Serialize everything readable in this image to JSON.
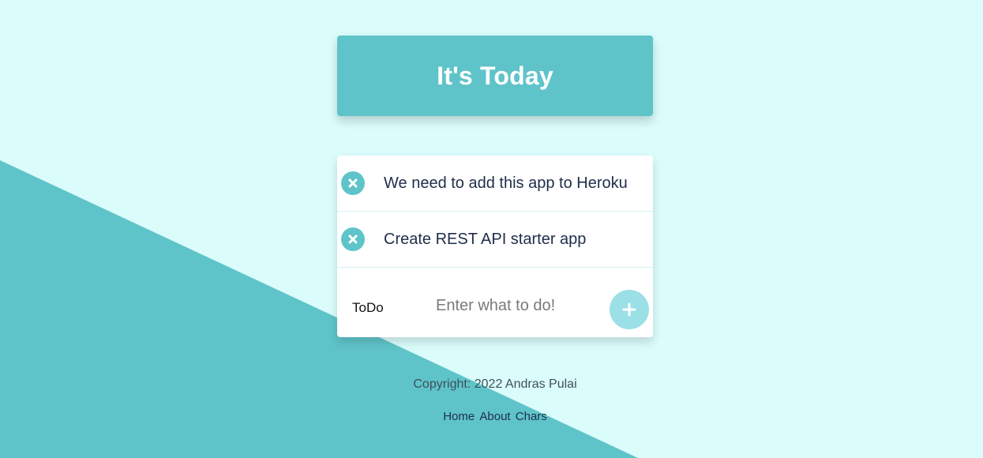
{
  "header": {
    "title": "It's Today"
  },
  "todos": [
    {
      "text": "We need to add this app to Heroku",
      "delete_icon": "close-icon"
    },
    {
      "text": "Create REST API starter app",
      "delete_icon": "close-icon"
    }
  ],
  "add_form": {
    "label": "ToDo",
    "placeholder": "Enter what to do!",
    "add_icon": "plus-icon"
  },
  "footer": {
    "copyright": "Copyright: 2022 Andras Pulai",
    "links": [
      "Home",
      "About",
      "Chars"
    ]
  },
  "colors": {
    "page_background": "#dafcfb",
    "accent": "#5fc4c9",
    "add_button": "#9ae0e6",
    "text_dark": "#1f2d4a"
  }
}
